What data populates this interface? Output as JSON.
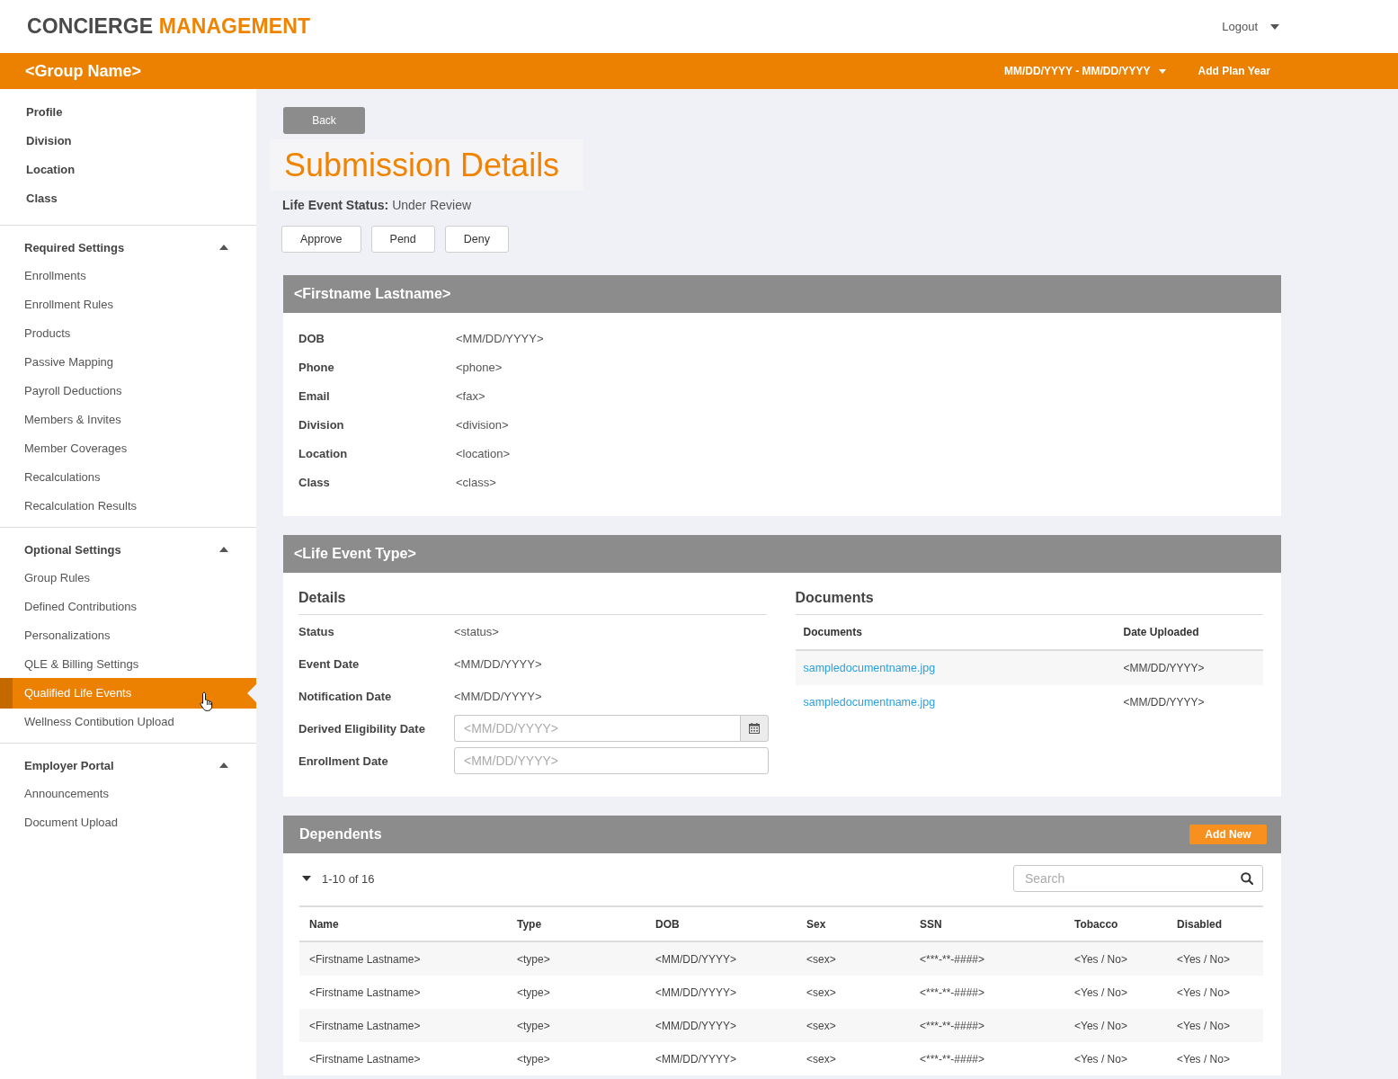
{
  "header": {
    "logo": {
      "primary": "CONCIERGE",
      "accent": "MANAGEMENT"
    },
    "user_menu": {
      "label": "Logout"
    }
  },
  "group_bar": {
    "title": "<Group Name>",
    "date_range": "MM/DD/YYYY - MM/DD/YYYY",
    "add_button": "Add Plan Year"
  },
  "sidebar": {
    "top_items": [
      {
        "label": "Profile",
        "selected": false
      },
      {
        "label": "Division",
        "selected": false
      },
      {
        "label": "Location",
        "selected": false
      },
      {
        "label": "Class",
        "selected": false
      }
    ],
    "sections": [
      {
        "title": "Required Settings",
        "expanded": true,
        "items": [
          {
            "label": "Enrollments",
            "selected": false
          },
          {
            "label": "Enrollment Rules",
            "selected": false
          },
          {
            "label": "Products",
            "selected": false
          },
          {
            "label": "Passive Mapping",
            "selected": false
          },
          {
            "label": "Payroll Deductions",
            "selected": false
          },
          {
            "label": "Members & Invites",
            "selected": false
          },
          {
            "label": "Member Coverages",
            "selected": false
          },
          {
            "label": "Recalculations",
            "selected": false
          },
          {
            "label": "Recalculation Results",
            "selected": false
          }
        ]
      },
      {
        "title": "Optional Settings",
        "expanded": true,
        "items": [
          {
            "label": "Group Rules",
            "selected": false
          },
          {
            "label": "Defined Contributions",
            "selected": false
          },
          {
            "label": "Personalizations",
            "selected": false
          },
          {
            "label": "QLE & Billing Settings",
            "selected": false
          },
          {
            "label": "Qualified Life Events",
            "selected": true
          },
          {
            "label": "Wellness Contibution Upload",
            "selected": false
          }
        ]
      },
      {
        "title": "Employer Portal",
        "expanded": true,
        "items": [
          {
            "label": "Announcements",
            "selected": false
          },
          {
            "label": "Document Upload",
            "selected": false
          }
        ]
      }
    ]
  },
  "page": {
    "back_button": "Back",
    "title": "Submission Details",
    "status": "**Life Event Status:** Under Review",
    "actions": [
      "Approve",
      "Pend",
      "Deny"
    ]
  },
  "member_card": {
    "title": "<Firstname Lastname>",
    "fields": [
      {
        "label": "DOB",
        "value": "<MM/DD/YYYY>"
      },
      {
        "label": "Phone",
        "value": "<phone>"
      },
      {
        "label": "Email",
        "value": "<fax>"
      },
      {
        "label": "Division",
        "value": "<division>"
      },
      {
        "label": "Location",
        "value": "<location>"
      },
      {
        "label": "Class",
        "value": "<class>"
      }
    ]
  },
  "life_event_card": {
    "title": "<Life Event Type>",
    "details": {
      "heading": "Details",
      "fields": [
        {
          "kind": "text",
          "label": "Status",
          "value": "<status>"
        },
        {
          "kind": "text",
          "label": "Event Date",
          "value": "<MM/DD/YYYY>"
        },
        {
          "kind": "text",
          "label": "Notification Date",
          "value": "<MM/DD/YYYY>"
        },
        {
          "kind": "date_picker",
          "label": "Derived Eligibility Date",
          "placeholder": "<MM/DD/YYYY>"
        },
        {
          "kind": "input",
          "label": "Enrollment Date",
          "placeholder": "<MM/DD/YYYY>"
        }
      ]
    },
    "documents": {
      "heading": "Documents",
      "columns": [
        "Documents",
        "Date Uploaded"
      ],
      "rows": [
        {
          "file": "sampledocumentname.jpg",
          "date": "<MM/DD/YYYY>"
        },
        {
          "file": "sampledocumentname.jpg",
          "date": "<MM/DD/YYYY>"
        }
      ]
    }
  },
  "dependents_card": {
    "title": "Dependents",
    "add_button": "Add New",
    "range": {
      "label": "1-10 of 16",
      "expanded": true
    },
    "search": {
      "placeholder": "Search"
    },
    "columns": [
      "Name",
      "Type",
      "DOB",
      "Sex",
      "SSN",
      "Tobacco",
      "Disabled"
    ],
    "rows": [
      [
        "<Firstname Lastname>",
        "<type>",
        "<MM/DD/YYYY>",
        "<sex>",
        "<***-**-####>",
        "<Yes / No>",
        "<Yes / No>"
      ],
      [
        "<Firstname Lastname>",
        "<type>",
        "<MM/DD/YYYY>",
        "<sex>",
        "<***-**-####>",
        "<Yes / No>",
        "<Yes / No>"
      ],
      [
        "<Firstname Lastname>",
        "<type>",
        "<MM/DD/YYYY>",
        "<sex>",
        "<***-**-####>",
        "<Yes / No>",
        "<Yes / No>"
      ],
      [
        "<Firstname Lastname>",
        "<type>",
        "<MM/DD/YYYY>",
        "<sex>",
        "<***-**-####>",
        "<Yes / No>",
        "<Yes / No>"
      ]
    ]
  }
}
